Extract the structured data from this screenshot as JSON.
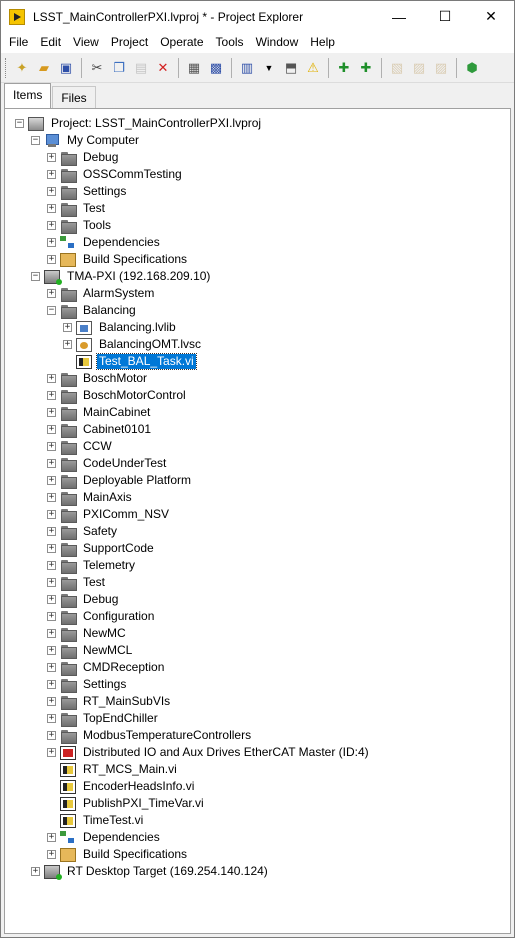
{
  "window": {
    "title": "LSST_MainControllerPXI.lvproj * - Project Explorer",
    "minimize": "—",
    "maximize": "☐",
    "close": "✕"
  },
  "menu": [
    "File",
    "Edit",
    "View",
    "Project",
    "Operate",
    "Tools",
    "Window",
    "Help"
  ],
  "tabs": [
    {
      "label": "Items",
      "active": true
    },
    {
      "label": "Files",
      "active": false
    }
  ],
  "tree": [
    {
      "label": "Project: LSST_MainControllerPXI.lvproj",
      "depth": 0,
      "icon": "project-icon",
      "exp": "−"
    },
    {
      "label": "My Computer",
      "depth": 1,
      "icon": "computer-icon",
      "exp": "−"
    },
    {
      "label": "Debug",
      "depth": 2,
      "icon": "folder-icon",
      "exp": "+"
    },
    {
      "label": "OSSCommTesting",
      "depth": 2,
      "icon": "folder-icon",
      "exp": "+"
    },
    {
      "label": "Settings",
      "depth": 2,
      "icon": "folder-icon",
      "exp": "+"
    },
    {
      "label": "Test",
      "depth": 2,
      "icon": "folder-icon",
      "exp": "+"
    },
    {
      "label": "Tools",
      "depth": 2,
      "icon": "folder-icon",
      "exp": "+"
    },
    {
      "label": "Dependencies",
      "depth": 2,
      "icon": "dependencies-icon",
      "exp": "+"
    },
    {
      "label": "Build Specifications",
      "depth": 2,
      "icon": "build-specifications-icon",
      "exp": "+"
    },
    {
      "label": "TMA-PXI (192.168.209.10)",
      "depth": 1,
      "icon": "rt-target-icon",
      "exp": "−"
    },
    {
      "label": "AlarmSystem",
      "depth": 2,
      "icon": "folder-icon",
      "exp": "+"
    },
    {
      "label": "Balancing",
      "depth": 2,
      "icon": "folder-icon",
      "exp": "−"
    },
    {
      "label": "Balancing.lvlib",
      "depth": 3,
      "icon": "lvlib-icon",
      "exp": "+"
    },
    {
      "label": "BalancingOMT.lvsc",
      "depth": 3,
      "icon": "lvsc-icon",
      "exp": "+"
    },
    {
      "label": "Test_BAL_Task.vi",
      "depth": 3,
      "icon": "vi-icon",
      "exp": "",
      "selected": true
    },
    {
      "label": "BoschMotor",
      "depth": 2,
      "icon": "folder-icon",
      "exp": "+"
    },
    {
      "label": "BoschMotorControl",
      "depth": 2,
      "icon": "folder-icon",
      "exp": "+"
    },
    {
      "label": "MainCabinet",
      "depth": 2,
      "icon": "folder-icon",
      "exp": "+"
    },
    {
      "label": "Cabinet0101",
      "depth": 2,
      "icon": "folder-icon",
      "exp": "+"
    },
    {
      "label": "CCW",
      "depth": 2,
      "icon": "folder-icon",
      "exp": "+"
    },
    {
      "label": "CodeUnderTest",
      "depth": 2,
      "icon": "folder-icon",
      "exp": "+"
    },
    {
      "label": "Deployable Platform",
      "depth": 2,
      "icon": "folder-icon",
      "exp": "+"
    },
    {
      "label": "MainAxis",
      "depth": 2,
      "icon": "folder-icon",
      "exp": "+"
    },
    {
      "label": "PXIComm_NSV",
      "depth": 2,
      "icon": "folder-icon",
      "exp": "+"
    },
    {
      "label": "Safety",
      "depth": 2,
      "icon": "folder-icon",
      "exp": "+"
    },
    {
      "label": "SupportCode",
      "depth": 2,
      "icon": "folder-icon",
      "exp": "+"
    },
    {
      "label": "Telemetry",
      "depth": 2,
      "icon": "folder-icon",
      "exp": "+"
    },
    {
      "label": "Test",
      "depth": 2,
      "icon": "folder-icon",
      "exp": "+"
    },
    {
      "label": "Debug",
      "depth": 2,
      "icon": "folder-icon",
      "exp": "+"
    },
    {
      "label": "Configuration",
      "depth": 2,
      "icon": "folder-icon",
      "exp": "+"
    },
    {
      "label": "NewMC",
      "depth": 2,
      "icon": "folder-icon",
      "exp": "+"
    },
    {
      "label": "NewMCL",
      "depth": 2,
      "icon": "folder-icon",
      "exp": "+"
    },
    {
      "label": "CMDReception",
      "depth": 2,
      "icon": "folder-icon",
      "exp": "+"
    },
    {
      "label": "Settings",
      "depth": 2,
      "icon": "folder-icon",
      "exp": "+"
    },
    {
      "label": "RT_MainSubVIs",
      "depth": 2,
      "icon": "folder-icon",
      "exp": "+"
    },
    {
      "label": "TopEndChiller",
      "depth": 2,
      "icon": "folder-icon",
      "exp": "+"
    },
    {
      "label": "ModbusTemperatureControllers",
      "depth": 2,
      "icon": "folder-icon",
      "exp": "+"
    },
    {
      "label": "Distributed IO and Aux Drives EtherCAT Master (ID:4)",
      "depth": 2,
      "icon": "ethercat-icon",
      "exp": "+"
    },
    {
      "label": "RT_MCS_Main.vi",
      "depth": 2,
      "icon": "vi-icon",
      "exp": ""
    },
    {
      "label": "EncoderHeadsInfo.vi",
      "depth": 2,
      "icon": "vi-icon",
      "exp": ""
    },
    {
      "label": "PublishPXI_TimeVar.vi",
      "depth": 2,
      "icon": "vi-icon",
      "exp": ""
    },
    {
      "label": "TimeTest.vi",
      "depth": 2,
      "icon": "vi-icon",
      "exp": ""
    },
    {
      "label": "Dependencies",
      "depth": 2,
      "icon": "dependencies-icon",
      "exp": "+"
    },
    {
      "label": "Build Specifications",
      "depth": 2,
      "icon": "build-specifications-icon",
      "exp": "+"
    },
    {
      "label": "RT Desktop Target (169.254.140.124)",
      "depth": 1,
      "icon": "rt-target-icon",
      "exp": "+"
    }
  ]
}
